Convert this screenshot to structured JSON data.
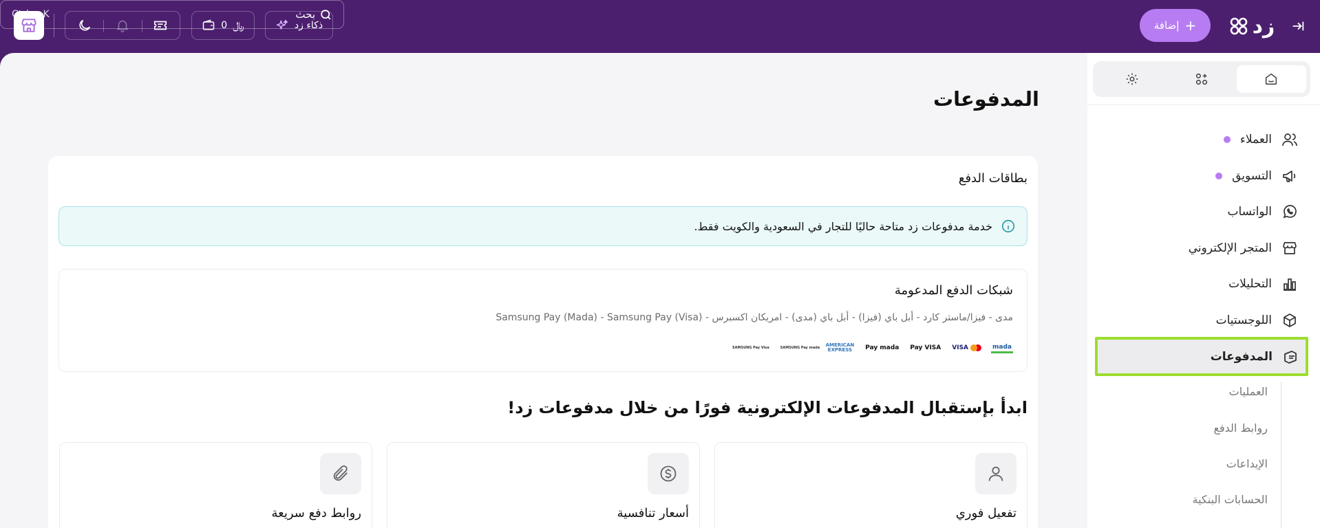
{
  "topbar": {
    "search_placeholder": "Ctrl + K",
    "search_label": "بحث",
    "add_label": "إضافة",
    "logo_text": "زد",
    "ai_label": "ذكاء زد",
    "wallet_value": "0",
    "currency_symbol": "﷼"
  },
  "main": {
    "page_title": "المدفوعات",
    "card_title": "بطاقات الدفع",
    "notice_text": "خدمة مدفوعات زد متاحة حاليًا للتجار في السعودية والكويت فقط.",
    "networks_title": "شبكات الدفع المدعومة",
    "networks_desc": "مدى - فيزا/ماستر كارد - أبل باي (فيزا) - أبل باي (مدى) - امريكان اكسبرس - Samsung Pay (Mada) - Samsung Pay (Visa)",
    "payment_logos": [
      {
        "name": "mada",
        "label": "mada"
      },
      {
        "name": "visa-mastercard",
        "label": "VISA"
      },
      {
        "name": "applepay-visa",
        "label": "Pay VISA"
      },
      {
        "name": "applepay-mada",
        "label": "Pay mada"
      },
      {
        "name": "amex",
        "label": "AMERICAN EXPRESS"
      },
      {
        "name": "samsungpay-mada",
        "label": "SAMSUNG Pay mada"
      },
      {
        "name": "samsungpay-visa",
        "label": "SAMSUNG Pay Visa"
      }
    ],
    "cta_title": "ابدأ بإستقبال المدفوعات الإلكترونية فورًا من خلال مدفوعات زد!",
    "features": [
      {
        "label": "تفعيل فوري",
        "icon": "user-icon"
      },
      {
        "label": "أسعار تنافسية",
        "icon": "dollar-icon"
      },
      {
        "label": "روابط دفع سريعة",
        "icon": "paperclip-icon"
      }
    ]
  },
  "sidebar": {
    "nav": [
      {
        "label": "العملاء",
        "icon": "users-icon",
        "dot": true
      },
      {
        "label": "التسويق",
        "icon": "megaphone-icon",
        "dot": true
      },
      {
        "label": "الواتساب",
        "icon": "whatsapp-icon",
        "dot": false
      },
      {
        "label": "المتجر الإلكتروني",
        "icon": "store-icon",
        "dot": false
      },
      {
        "label": "التحليلات",
        "icon": "bar-chart-icon",
        "dot": false
      },
      {
        "label": "اللوجستيات",
        "icon": "box-icon",
        "dot": false
      },
      {
        "label": "المدفوعات",
        "icon": "payments-icon",
        "dot": false
      }
    ],
    "sub": [
      "العمليات",
      "روابط الدفع",
      "الإيداعات",
      "الحسابات البنكية"
    ]
  },
  "colors": {
    "topbar_bg": "#4b1f6e",
    "accent": "#b77cf2",
    "highlight": "#9cdd2f"
  }
}
